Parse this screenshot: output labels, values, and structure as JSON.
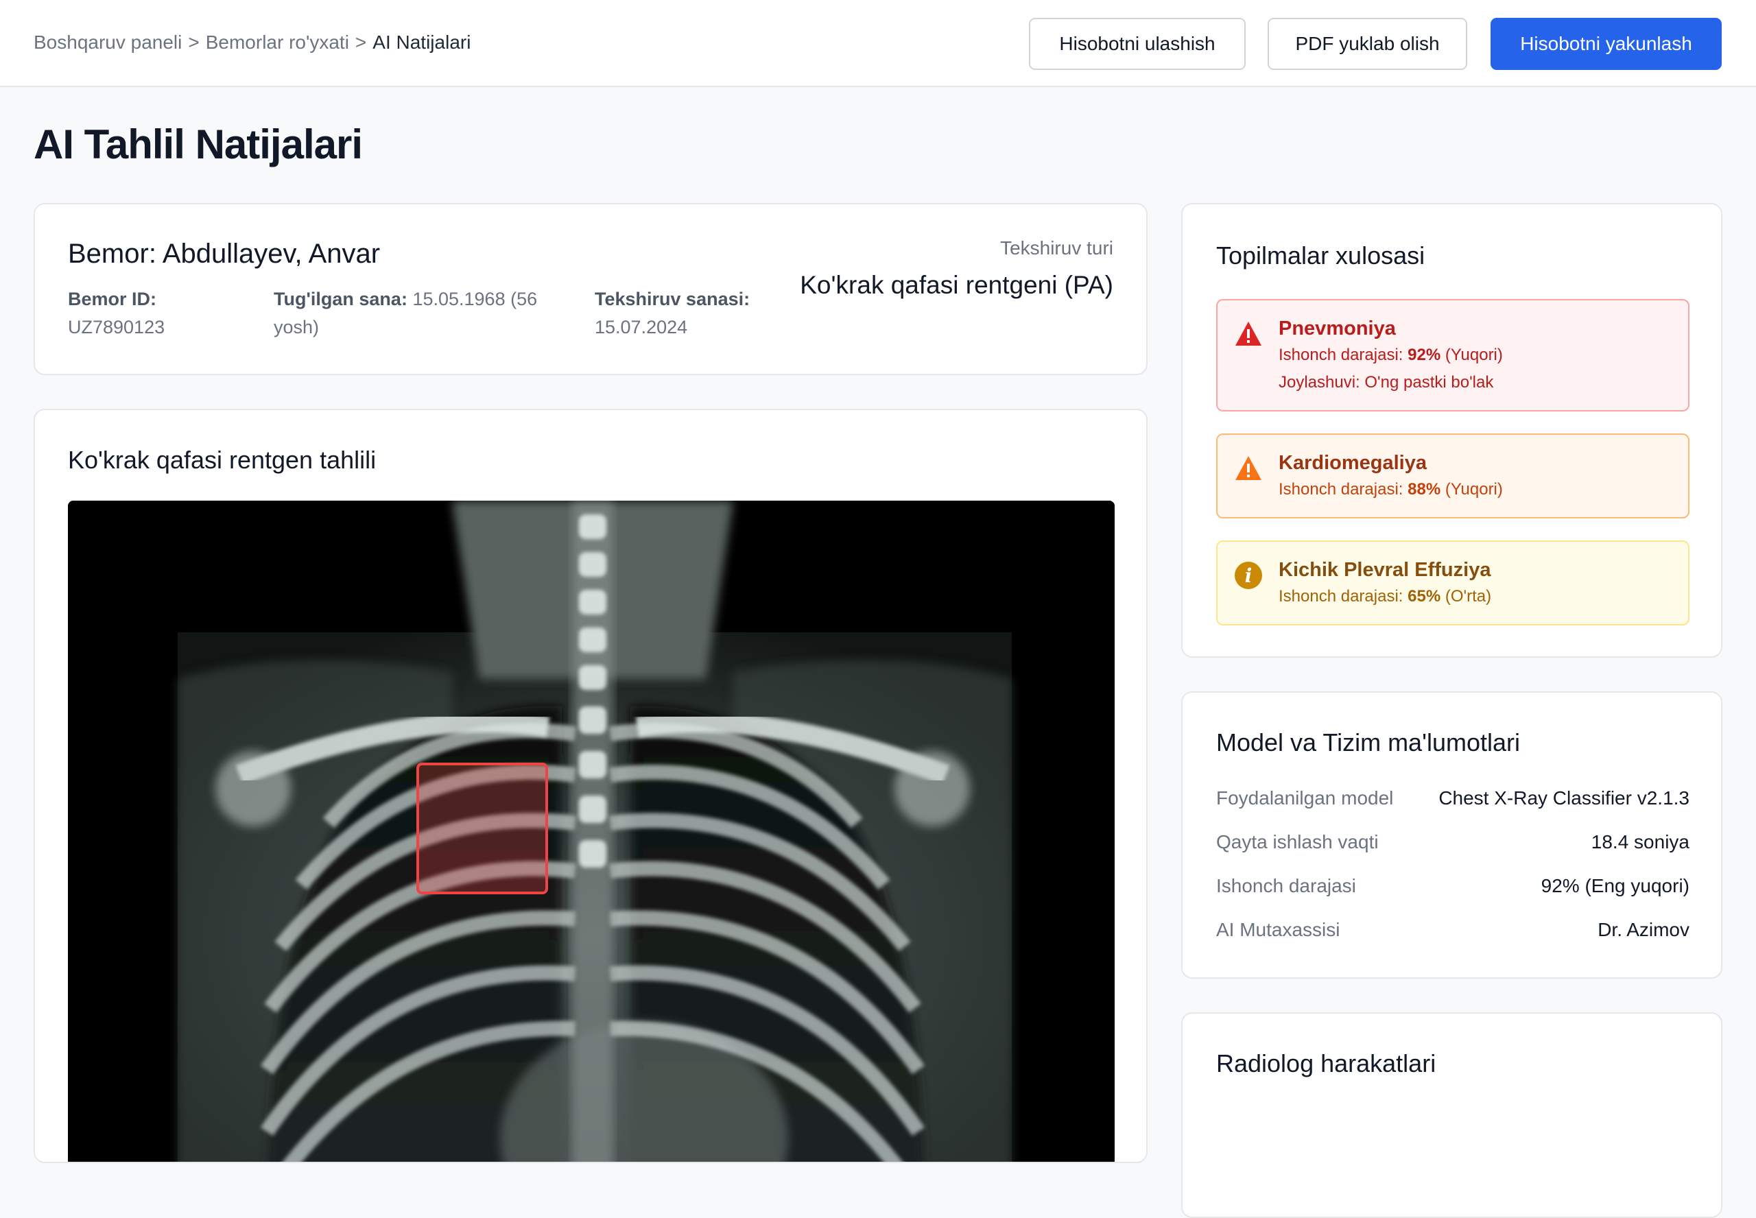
{
  "breadcrumb": [
    {
      "label": "Boshqaruv paneli"
    },
    {
      "label": "Bemorlar ro'yxati"
    },
    {
      "label": "AI Natijalari"
    }
  ],
  "breadcrumb_separator": ">",
  "header_buttons": {
    "share": "Hisobotni ulashish",
    "pdf": "PDF yuklab olish",
    "finalize": "Hisobotni yakunlash"
  },
  "page_title": "AI Tahlil Natijalari",
  "patient": {
    "name": "Bemor: Abdullayev, Anvar",
    "id_label": "Bemor ID:",
    "id_value": "UZ7890123",
    "dob_label": "Tug'ilgan sana:",
    "dob_value": "15.05.1968 (56 yosh)",
    "exam_date_label": "Tekshiruv sanasi:",
    "exam_date_value": "15.07.2024",
    "exam_type_label": "Tekshiruv turi",
    "exam_type_value": "Ko'krak qafasi rentgeni (PA)"
  },
  "xray_panel": {
    "title": "Ko'krak qafasi rentgen tahlili"
  },
  "findings_panel": {
    "title": "Topilmalar xulosasi",
    "confidence_label": "Ishonch darajasi:",
    "items": [
      {
        "name": "Pnevmoniya",
        "confidence": "92%",
        "level": "(Yuqori)",
        "location": "Joylashuvi: O'ng pastki bo'lak",
        "icon": "warning-triangle-icon",
        "color": "#dc2626"
      },
      {
        "name": "Kardiomegaliya",
        "confidence": "88%",
        "level": "(Yuqori)",
        "icon": "warning-triangle-icon",
        "color": "#f97316"
      },
      {
        "name": "Kichik Plevral Effuziya",
        "confidence": "65%",
        "level": "(O'rta)",
        "icon": "info-circle-icon",
        "color": "#ca8a04"
      }
    ]
  },
  "model_panel": {
    "title": "Model va Tizim ma'lumotlari",
    "rows": [
      {
        "label": "Foydalanilgan model",
        "value": "Chest X-Ray Classifier v2.1.3"
      },
      {
        "label": "Qayta ishlash vaqti",
        "value": "18.4 soniya"
      },
      {
        "label": "Ishonch darajasi",
        "value": "92% (Eng yuqori)"
      },
      {
        "label": "AI Mutaxassisi",
        "value": "Dr. Azimov"
      }
    ]
  },
  "radiologist_panel": {
    "title": "Radiolog harakatlari"
  },
  "colors": {
    "primary": "#2563eb",
    "danger": "#dc2626",
    "warning": "#f97316",
    "caution": "#ca8a04"
  }
}
